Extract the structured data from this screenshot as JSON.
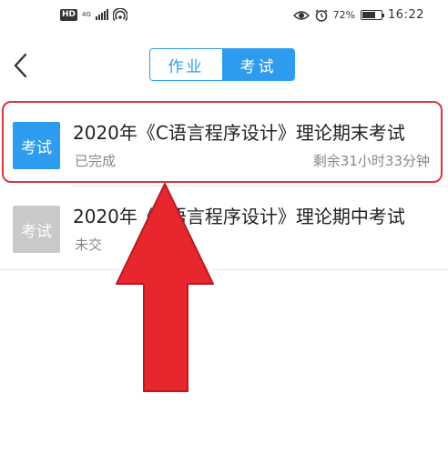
{
  "statusbar": {
    "hd": "HD",
    "network": "4G",
    "battery": "72%",
    "battery_level": 0.72,
    "time": "16:22"
  },
  "header": {
    "tabs": [
      {
        "label": "作业",
        "active": false
      },
      {
        "label": "考试",
        "active": true
      }
    ]
  },
  "exams": [
    {
      "badge": "考试",
      "title": "2020年《C语言程序设计》理论期末考试",
      "status": "已完成",
      "remaining": "剩余31小时33分钟",
      "badge_color": "#2d9cef"
    },
    {
      "badge": "考试",
      "title": "2020年《C语言程序设计》理论期中考试",
      "status": "未交",
      "remaining": "",
      "badge_color": "#c9c9c9"
    }
  ],
  "colors": {
    "accent": "#2d9cef",
    "highlight": "#d9363e",
    "arrow": "#e8262e"
  },
  "icons": {
    "back": "chevron-left-icon",
    "signal": "signal-icon",
    "hotspot": "hotspot-icon",
    "eye": "eye-icon",
    "alarm": "alarm-icon",
    "battery": "battery-icon"
  }
}
